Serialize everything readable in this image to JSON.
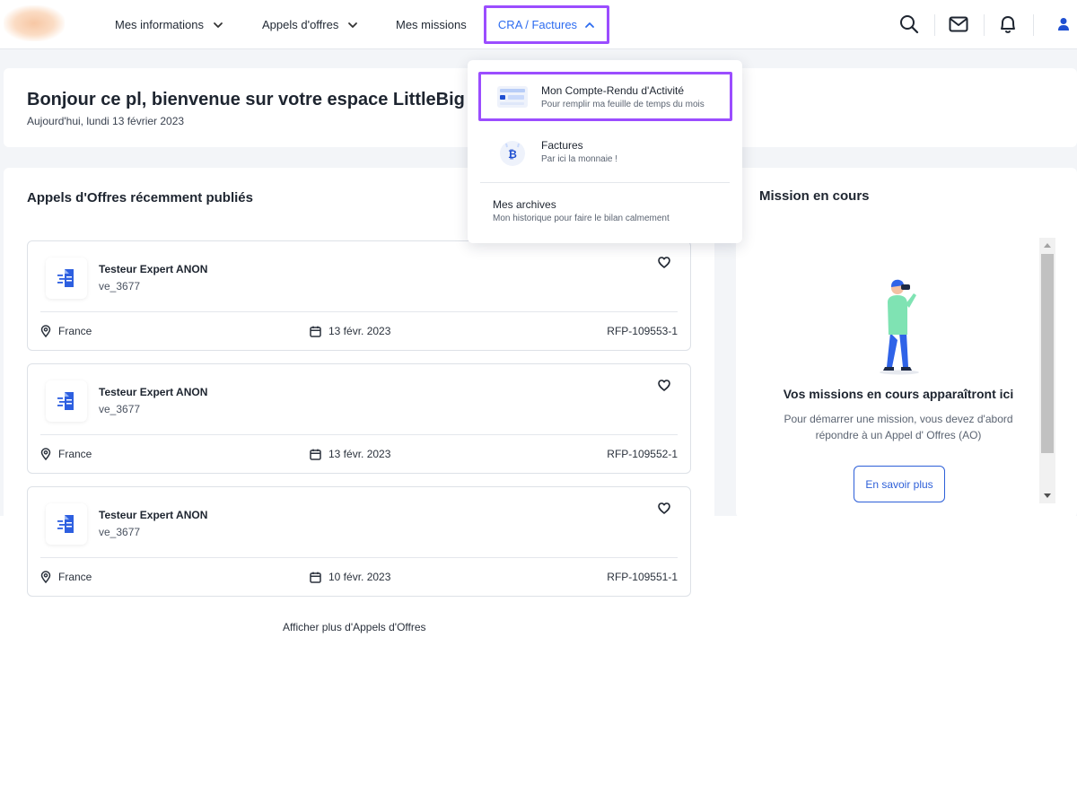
{
  "nav": {
    "items": [
      {
        "label": "Mes informations",
        "has_chevron": true
      },
      {
        "label": "Appels d'offres",
        "has_chevron": true
      },
      {
        "label": "Mes missions",
        "has_chevron": false
      }
    ],
    "active": {
      "label": "CRA / Factures",
      "chevron": "chevron-up-icon"
    }
  },
  "header_icons": [
    "search-icon",
    "mail-icon",
    "bell-icon",
    "user-icon"
  ],
  "dropdown": {
    "items": [
      {
        "title": "Mon Compte-Rendu d'Activité",
        "subtitle": "Pour remplir ma feuille de temps du mois",
        "icon": "timesheet-icon"
      },
      {
        "title": "Factures",
        "subtitle": "Par ici la monnaie !",
        "icon": "invoice-icon"
      },
      {
        "title": "Mes archives",
        "subtitle": "Mon historique pour faire le bilan calmement"
      }
    ]
  },
  "welcome": {
    "title": "Bonjour ce pl, bienvenue sur votre espace LittleBig Connection",
    "date": "Aujourd'hui, lundi 13 février 2023"
  },
  "offers": {
    "title": "Appels d'Offres récemment publiés",
    "items": [
      {
        "title": "Testeur Expert ANON",
        "subtitle": "ve_3677",
        "location": "France",
        "date": "13 févr. 2023",
        "ref": "RFP-109553-1"
      },
      {
        "title": "Testeur Expert ANON",
        "subtitle": "ve_3677",
        "location": "France",
        "date": "13 févr. 2023",
        "ref": "RFP-109552-1"
      },
      {
        "title": "Testeur Expert ANON",
        "subtitle": "ve_3677",
        "location": "France",
        "date": "10 févr. 2023",
        "ref": "RFP-109551-1"
      }
    ],
    "more_link": "Afficher plus d'Appels d'Offres"
  },
  "mission": {
    "title": "Mission en cours",
    "empty_title": "Vos missions en cours apparaîtront ici",
    "empty_text": "Pour démarrer une mission, vous devez d'abord répondre à un Appel d' Offres (AO)",
    "button": "En savoir plus"
  },
  "colors": {
    "accent_blue": "#2d6cf0",
    "highlight_purple": "#9b4dff",
    "button_blue": "#2d5fd8"
  }
}
